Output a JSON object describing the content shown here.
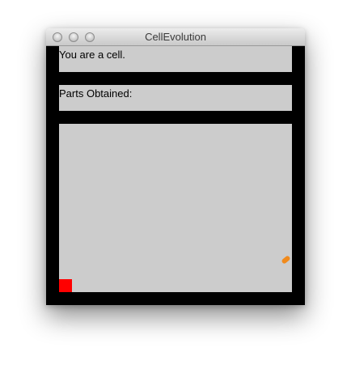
{
  "window": {
    "title": "CellEvolution"
  },
  "status": {
    "message": "You are a cell."
  },
  "parts": {
    "label": "Parts Obtained:"
  },
  "game": {
    "background_color": "#cccccc",
    "player_color": "#ff0000",
    "part_color": "#f08a1c",
    "frame_color": "#000000"
  },
  "icons": {
    "close": "close-button-icon",
    "minimize": "minimize-button-icon",
    "zoom": "zoom-button-icon"
  }
}
